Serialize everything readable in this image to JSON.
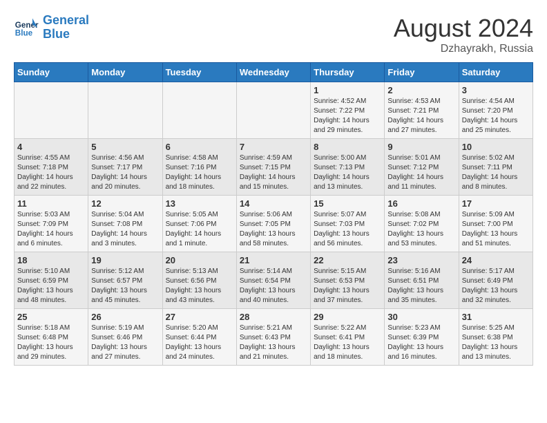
{
  "header": {
    "logo_line1": "General",
    "logo_line2": "Blue",
    "month": "August 2024",
    "location": "Dzhayrakh, Russia"
  },
  "days_of_week": [
    "Sunday",
    "Monday",
    "Tuesday",
    "Wednesday",
    "Thursday",
    "Friday",
    "Saturday"
  ],
  "weeks": [
    [
      {
        "day": "",
        "info": ""
      },
      {
        "day": "",
        "info": ""
      },
      {
        "day": "",
        "info": ""
      },
      {
        "day": "",
        "info": ""
      },
      {
        "day": "1",
        "info": "Sunrise: 4:52 AM\nSunset: 7:22 PM\nDaylight: 14 hours\nand 29 minutes."
      },
      {
        "day": "2",
        "info": "Sunrise: 4:53 AM\nSunset: 7:21 PM\nDaylight: 14 hours\nand 27 minutes."
      },
      {
        "day": "3",
        "info": "Sunrise: 4:54 AM\nSunset: 7:20 PM\nDaylight: 14 hours\nand 25 minutes."
      }
    ],
    [
      {
        "day": "4",
        "info": "Sunrise: 4:55 AM\nSunset: 7:18 PM\nDaylight: 14 hours\nand 22 minutes."
      },
      {
        "day": "5",
        "info": "Sunrise: 4:56 AM\nSunset: 7:17 PM\nDaylight: 14 hours\nand 20 minutes."
      },
      {
        "day": "6",
        "info": "Sunrise: 4:58 AM\nSunset: 7:16 PM\nDaylight: 14 hours\nand 18 minutes."
      },
      {
        "day": "7",
        "info": "Sunrise: 4:59 AM\nSunset: 7:15 PM\nDaylight: 14 hours\nand 15 minutes."
      },
      {
        "day": "8",
        "info": "Sunrise: 5:00 AM\nSunset: 7:13 PM\nDaylight: 14 hours\nand 13 minutes."
      },
      {
        "day": "9",
        "info": "Sunrise: 5:01 AM\nSunset: 7:12 PM\nDaylight: 14 hours\nand 11 minutes."
      },
      {
        "day": "10",
        "info": "Sunrise: 5:02 AM\nSunset: 7:11 PM\nDaylight: 14 hours\nand 8 minutes."
      }
    ],
    [
      {
        "day": "11",
        "info": "Sunrise: 5:03 AM\nSunset: 7:09 PM\nDaylight: 14 hours\nand 6 minutes."
      },
      {
        "day": "12",
        "info": "Sunrise: 5:04 AM\nSunset: 7:08 PM\nDaylight: 14 hours\nand 3 minutes."
      },
      {
        "day": "13",
        "info": "Sunrise: 5:05 AM\nSunset: 7:06 PM\nDaylight: 14 hours\nand 1 minute."
      },
      {
        "day": "14",
        "info": "Sunrise: 5:06 AM\nSunset: 7:05 PM\nDaylight: 13 hours\nand 58 minutes."
      },
      {
        "day": "15",
        "info": "Sunrise: 5:07 AM\nSunset: 7:03 PM\nDaylight: 13 hours\nand 56 minutes."
      },
      {
        "day": "16",
        "info": "Sunrise: 5:08 AM\nSunset: 7:02 PM\nDaylight: 13 hours\nand 53 minutes."
      },
      {
        "day": "17",
        "info": "Sunrise: 5:09 AM\nSunset: 7:00 PM\nDaylight: 13 hours\nand 51 minutes."
      }
    ],
    [
      {
        "day": "18",
        "info": "Sunrise: 5:10 AM\nSunset: 6:59 PM\nDaylight: 13 hours\nand 48 minutes."
      },
      {
        "day": "19",
        "info": "Sunrise: 5:12 AM\nSunset: 6:57 PM\nDaylight: 13 hours\nand 45 minutes."
      },
      {
        "day": "20",
        "info": "Sunrise: 5:13 AM\nSunset: 6:56 PM\nDaylight: 13 hours\nand 43 minutes."
      },
      {
        "day": "21",
        "info": "Sunrise: 5:14 AM\nSunset: 6:54 PM\nDaylight: 13 hours\nand 40 minutes."
      },
      {
        "day": "22",
        "info": "Sunrise: 5:15 AM\nSunset: 6:53 PM\nDaylight: 13 hours\nand 37 minutes."
      },
      {
        "day": "23",
        "info": "Sunrise: 5:16 AM\nSunset: 6:51 PM\nDaylight: 13 hours\nand 35 minutes."
      },
      {
        "day": "24",
        "info": "Sunrise: 5:17 AM\nSunset: 6:49 PM\nDaylight: 13 hours\nand 32 minutes."
      }
    ],
    [
      {
        "day": "25",
        "info": "Sunrise: 5:18 AM\nSunset: 6:48 PM\nDaylight: 13 hours\nand 29 minutes."
      },
      {
        "day": "26",
        "info": "Sunrise: 5:19 AM\nSunset: 6:46 PM\nDaylight: 13 hours\nand 27 minutes."
      },
      {
        "day": "27",
        "info": "Sunrise: 5:20 AM\nSunset: 6:44 PM\nDaylight: 13 hours\nand 24 minutes."
      },
      {
        "day": "28",
        "info": "Sunrise: 5:21 AM\nSunset: 6:43 PM\nDaylight: 13 hours\nand 21 minutes."
      },
      {
        "day": "29",
        "info": "Sunrise: 5:22 AM\nSunset: 6:41 PM\nDaylight: 13 hours\nand 18 minutes."
      },
      {
        "day": "30",
        "info": "Sunrise: 5:23 AM\nSunset: 6:39 PM\nDaylight: 13 hours\nand 16 minutes."
      },
      {
        "day": "31",
        "info": "Sunrise: 5:25 AM\nSunset: 6:38 PM\nDaylight: 13 hours\nand 13 minutes."
      }
    ]
  ]
}
